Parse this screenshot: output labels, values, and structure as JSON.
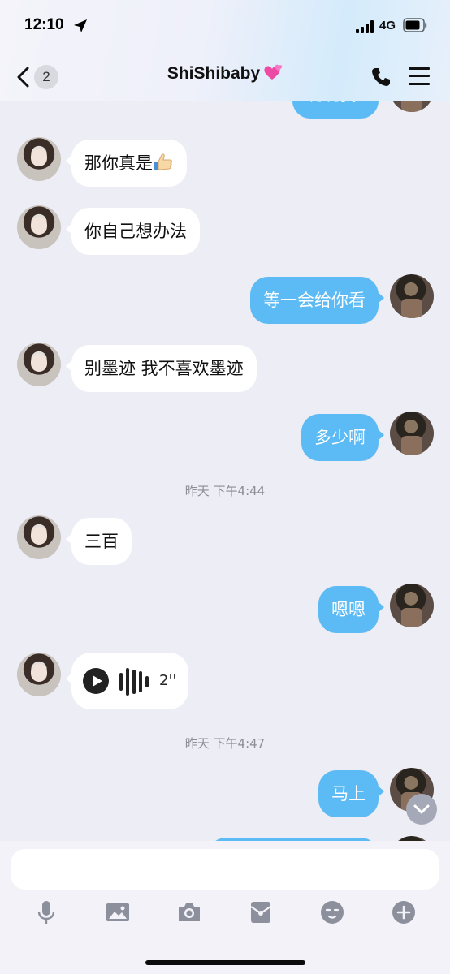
{
  "status_bar": {
    "time": "12:10",
    "network": "4G"
  },
  "nav": {
    "back_count": "2",
    "title": "ShiShibaby"
  },
  "chat": {
    "partial_top": "说说我?",
    "messages": [
      {
        "side": "left",
        "text": "那你真是"
      },
      {
        "side": "left",
        "text": "你自己想办法"
      },
      {
        "side": "right",
        "text": "等一会给你看"
      },
      {
        "side": "left",
        "text": "别墨迹 我不喜欢墨迹"
      },
      {
        "side": "right",
        "text": "多少啊"
      },
      {
        "side": "left",
        "text": "三百"
      },
      {
        "side": "right",
        "text": "嗯嗯"
      },
      {
        "side": "right",
        "text": "马上"
      }
    ],
    "timestamps": [
      "昨天 下午4:44",
      "昨天 下午4:47"
    ],
    "voice": {
      "duration": "2''"
    }
  },
  "input": {
    "value": "",
    "placeholder": ""
  },
  "toolbar": [
    "mic-icon",
    "image-icon",
    "camera-icon",
    "red-packet-icon",
    "emoji-icon",
    "plus-icon"
  ],
  "colors": {
    "bubble_right": "#5cbaf4",
    "bubble_left": "#ffffff",
    "background": "#ededf6"
  }
}
